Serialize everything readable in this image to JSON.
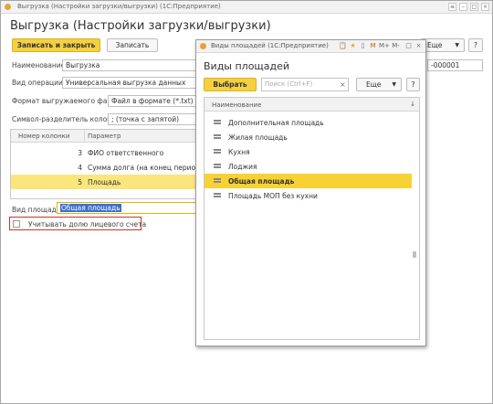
{
  "main": {
    "window_title": "Выгрузка (Настройки загрузки/выгрузки)  (1С:Предприятие)",
    "heading": "Выгрузка (Настройки загрузки/выгрузки)",
    "save_close_label": "Записать и закрыть",
    "save_label": "Записать",
    "more_label": "Еще",
    "help_label": "?",
    "code_value": "-000001",
    "name_label": "Наименование:",
    "name_value": "Выгрузка",
    "operation_label": "Вид операции:",
    "operation_value": "Универсальная выгрузка данных",
    "format_label": "Формат выгружаемого файла:",
    "format_value": "Файл в формате (*.txt)",
    "separator_label": "Символ-разделитель колонок:",
    "separator_value": ";   (точка с запятой)",
    "table": {
      "col_number": "Номер колонки",
      "col_param": "Параметр",
      "rows": [
        {
          "number": "3",
          "param": "ФИО ответственного"
        },
        {
          "number": "4",
          "param": "Сумма долга (на конец периода)"
        },
        {
          "number": "5",
          "param": "Площадь"
        }
      ]
    },
    "area_type_label": "Вид площади:",
    "area_type_value": "Общая площадь",
    "account_share_label": "Учитывать долю лицевого счета"
  },
  "dialog": {
    "window_title": "Виды площадей  (1С:Предприятие)",
    "toolbar_icons": [
      "📋",
      "★",
      "▯",
      "M",
      "M+",
      "M-",
      "□",
      "×"
    ],
    "heading": "Виды площадей",
    "select_label": "Выбрать",
    "search_placeholder": "Поиск (Ctrl+F)",
    "search_clear": "×",
    "more_label": "Еще",
    "help_label": "?",
    "list_header": "Наименование",
    "sort_icon": "↓",
    "items": [
      "Дополнительная площадь",
      "Жилая площадь",
      "Кухня",
      "Лоджия",
      "Общая площадь",
      "Площадь МОП без кухни"
    ],
    "selected_index": 4
  },
  "colors": {
    "accent_yellow": "#f5d142",
    "selection_yellow": "#f7d235",
    "focus_red": "#c0392b"
  }
}
